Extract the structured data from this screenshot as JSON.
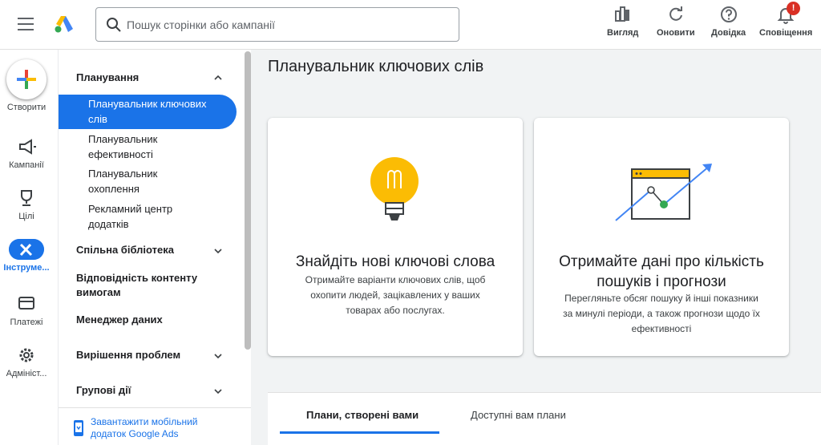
{
  "header": {
    "search_placeholder": "Пошук сторінки або кампанії",
    "tools": [
      {
        "label": "Вигляд",
        "icon": "appearance-icon"
      },
      {
        "label": "Оновити",
        "icon": "refresh-icon"
      },
      {
        "label": "Довідка",
        "icon": "help-icon"
      },
      {
        "label": "Сповіщення",
        "icon": "bell-icon",
        "badge": "!"
      }
    ]
  },
  "rail": {
    "create_label": "Створити",
    "items": [
      {
        "label": "Кампанії",
        "icon": "campaigns-icon"
      },
      {
        "label": "Цілі",
        "icon": "trophy-icon"
      },
      {
        "label": "Інструме...",
        "icon": "tools-icon",
        "active": true
      },
      {
        "label": "Платежі",
        "icon": "billing-icon"
      },
      {
        "label": "Адмініст...",
        "icon": "gear-icon"
      }
    ]
  },
  "nav": {
    "section_planning": "Планування",
    "active_item_line1": "Планувальник ключових",
    "active_item_line2": "слів",
    "items": [
      {
        "line1": "Планувальник",
        "line2": "ефективності"
      },
      {
        "line1": "Планувальник",
        "line2": "охоплення"
      },
      {
        "line1": "Рекламний центр",
        "line2": "додатків"
      }
    ],
    "shared_library": "Спільна бібліотека",
    "content_suitability_line1": "Відповідність контенту",
    "content_suitability_line2": "вимогам",
    "data_manager": "Менеджер даних",
    "troubleshooting": "Вирішення проблем",
    "bulk_actions": "Групові дії",
    "mobile_app_line1": "Завантажити мобільний",
    "mobile_app_line2": "додаток Google Ads"
  },
  "main": {
    "title": "Планувальник ключових слів",
    "card1": {
      "title": "Знайдіть нові ключові слова",
      "desc_line1": "Отримайте варіанти ключових слів, щоб",
      "desc_line2": "охопити людей, зацікавлених у ваших",
      "desc_line3": "товарах або послугах."
    },
    "card2": {
      "title_line1": "Отримайте дані про кількість",
      "title_line2": "пошуків і прогнози",
      "desc_line1": "Перегляньте обсяг пошуку й інші показники",
      "desc_line2": "за минулі періоди, а також прогнози щодо їх",
      "desc_line3": "ефективності"
    },
    "tabs": [
      {
        "label": "Плани, створені вами",
        "active": true
      },
      {
        "label": "Доступні вам плани",
        "active": false
      }
    ]
  },
  "colors": {
    "accent": "#1a73e8",
    "badge": "#d93025",
    "bulb": "#fbbc04",
    "chart_dot": "#34a853"
  }
}
